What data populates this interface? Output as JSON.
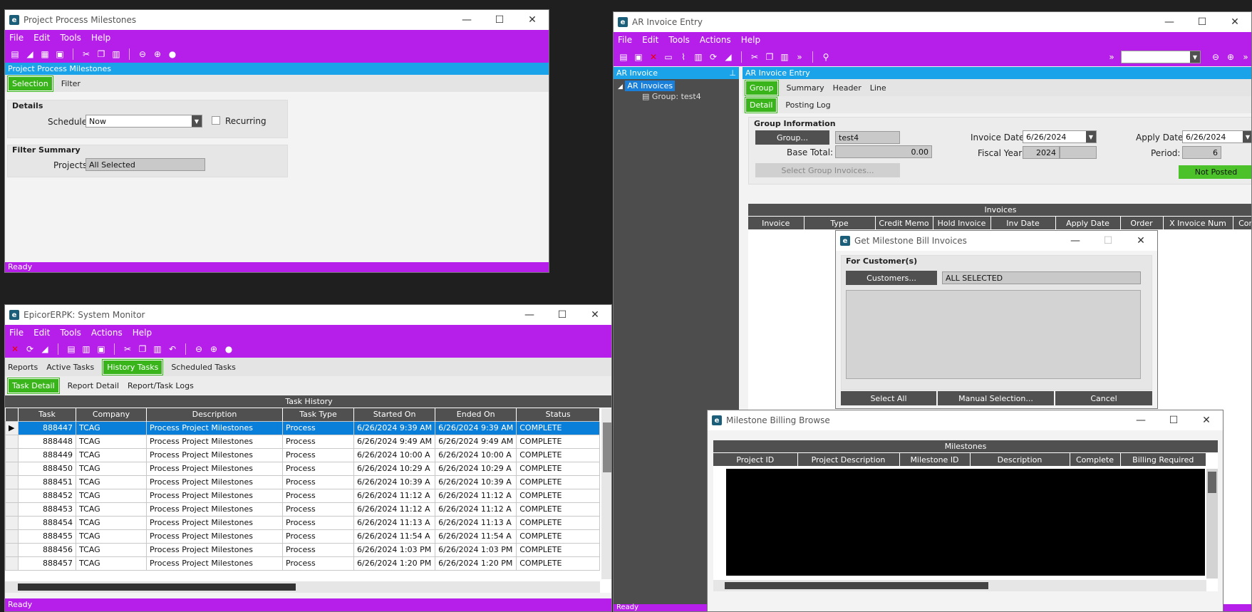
{
  "ppm": {
    "title": "Project Process Milestones",
    "menu": [
      "File",
      "Edit",
      "Tools",
      "Help"
    ],
    "panel_header": "Project Process Milestones",
    "tabs": [
      "Selection",
      "Filter"
    ],
    "details_label": "Details",
    "schedule_label": "Schedule:",
    "schedule_value": "Now",
    "recurring_label": "Recurring",
    "filter_summary_label": "Filter Summary",
    "projects_label": "Projects:",
    "projects_value": "All Selected",
    "status": "Ready"
  },
  "sysmon": {
    "title": "EpicorERPK: System Monitor",
    "menu": [
      "File",
      "Edit",
      "Tools",
      "Actions",
      "Help"
    ],
    "tabs": [
      "Reports",
      "Active Tasks",
      "History Tasks",
      "Scheduled Tasks"
    ],
    "subtabs": [
      "Task Detail",
      "Report Detail",
      "Report/Task Logs"
    ],
    "grid_title": "Task History",
    "columns": [
      "Task",
      "Company",
      "Description",
      "Task Type",
      "Started On",
      "Ended On",
      "Status"
    ],
    "rows": [
      [
        "888447",
        "TCAG",
        "Process Project Milestones",
        "Process",
        "6/26/2024 9:39 AM",
        "6/26/2024 9:39 AM",
        "COMPLETE"
      ],
      [
        "888448",
        "TCAG",
        "Process Project Milestones",
        "Process",
        "6/26/2024 9:49 AM",
        "6/26/2024 9:49 AM",
        "COMPLETE"
      ],
      [
        "888449",
        "TCAG",
        "Process Project Milestones",
        "Process",
        "6/26/2024 10:00 A",
        "6/26/2024 10:00 A",
        "COMPLETE"
      ],
      [
        "888450",
        "TCAG",
        "Process Project Milestones",
        "Process",
        "6/26/2024 10:29 A",
        "6/26/2024 10:29 A",
        "COMPLETE"
      ],
      [
        "888451",
        "TCAG",
        "Process Project Milestones",
        "Process",
        "6/26/2024 10:39 A",
        "6/26/2024 10:39 A",
        "COMPLETE"
      ],
      [
        "888452",
        "TCAG",
        "Process Project Milestones",
        "Process",
        "6/26/2024 11:12 A",
        "6/26/2024 11:12 A",
        "COMPLETE"
      ],
      [
        "888453",
        "TCAG",
        "Process Project Milestones",
        "Process",
        "6/26/2024 11:12 A",
        "6/26/2024 11:12 A",
        "COMPLETE"
      ],
      [
        "888454",
        "TCAG",
        "Process Project Milestones",
        "Process",
        "6/26/2024 11:13 A",
        "6/26/2024 11:13 A",
        "COMPLETE"
      ],
      [
        "888455",
        "TCAG",
        "Process Project Milestones",
        "Process",
        "6/26/2024 11:54 A",
        "6/26/2024 11:54 A",
        "COMPLETE"
      ],
      [
        "888456",
        "TCAG",
        "Process Project Milestones",
        "Process",
        "6/26/2024 1:03 PM",
        "6/26/2024 1:03 PM",
        "COMPLETE"
      ],
      [
        "888457",
        "TCAG",
        "Process Project Milestones",
        "Process",
        "6/26/2024 1:20 PM",
        "6/26/2024 1:20 PM",
        "COMPLETE"
      ]
    ],
    "status": "Ready"
  },
  "ar": {
    "title": "AR Invoice Entry",
    "menu": [
      "File",
      "Edit",
      "Tools",
      "Actions",
      "Help"
    ],
    "tree_header": "AR Invoice",
    "tree_root": "AR Invoices",
    "tree_child": "Group: test4",
    "panel_header": "AR Invoice Entry",
    "tabs": [
      "Group",
      "Summary",
      "Header",
      "Line"
    ],
    "subtabs": [
      "Detail",
      "Posting Log"
    ],
    "group_info_label": "Group Information",
    "group_button": "Group...",
    "group_value": "test4",
    "base_total_label": "Base Total:",
    "base_total_value": "0.00",
    "select_group_invoices": "Select Group Invoices...",
    "invoice_date_label": "Invoice Date:",
    "invoice_date_value": "6/26/2024",
    "fiscal_year_label": "Fiscal Year:",
    "fiscal_year_value": "2024",
    "apply_date_label": "Apply Date:",
    "apply_date_value": "6/26/2024",
    "period_label": "Period:",
    "period_value": "6",
    "posted_status": "Not Posted",
    "invoices_grid_title": "Invoices",
    "invoice_columns": [
      "Invoice",
      "Type",
      "Credit Memo",
      "Hold Invoice",
      "Inv Date",
      "Apply Date",
      "Order",
      "X Invoice Num",
      "Corr"
    ],
    "status": "Ready"
  },
  "gmbi": {
    "title": "Get Milestone Bill Invoices",
    "for_customers_label": "For Customer(s)",
    "customers_button": "Customers...",
    "customers_value": "ALL SELECTED",
    "select_all": "Select All",
    "manual_selection": "Manual Selection...",
    "cancel": "Cancel"
  },
  "mbb": {
    "title": "Milestone Billing Browse",
    "grid_title": "Milestones",
    "columns": [
      "Project ID",
      "Project Description",
      "Milestone ID",
      "Description",
      "Complete",
      "Billing Required"
    ]
  },
  "colors": {
    "menu": "#b61fea",
    "accent": "#39b51b",
    "header": "#1aa3e8"
  }
}
